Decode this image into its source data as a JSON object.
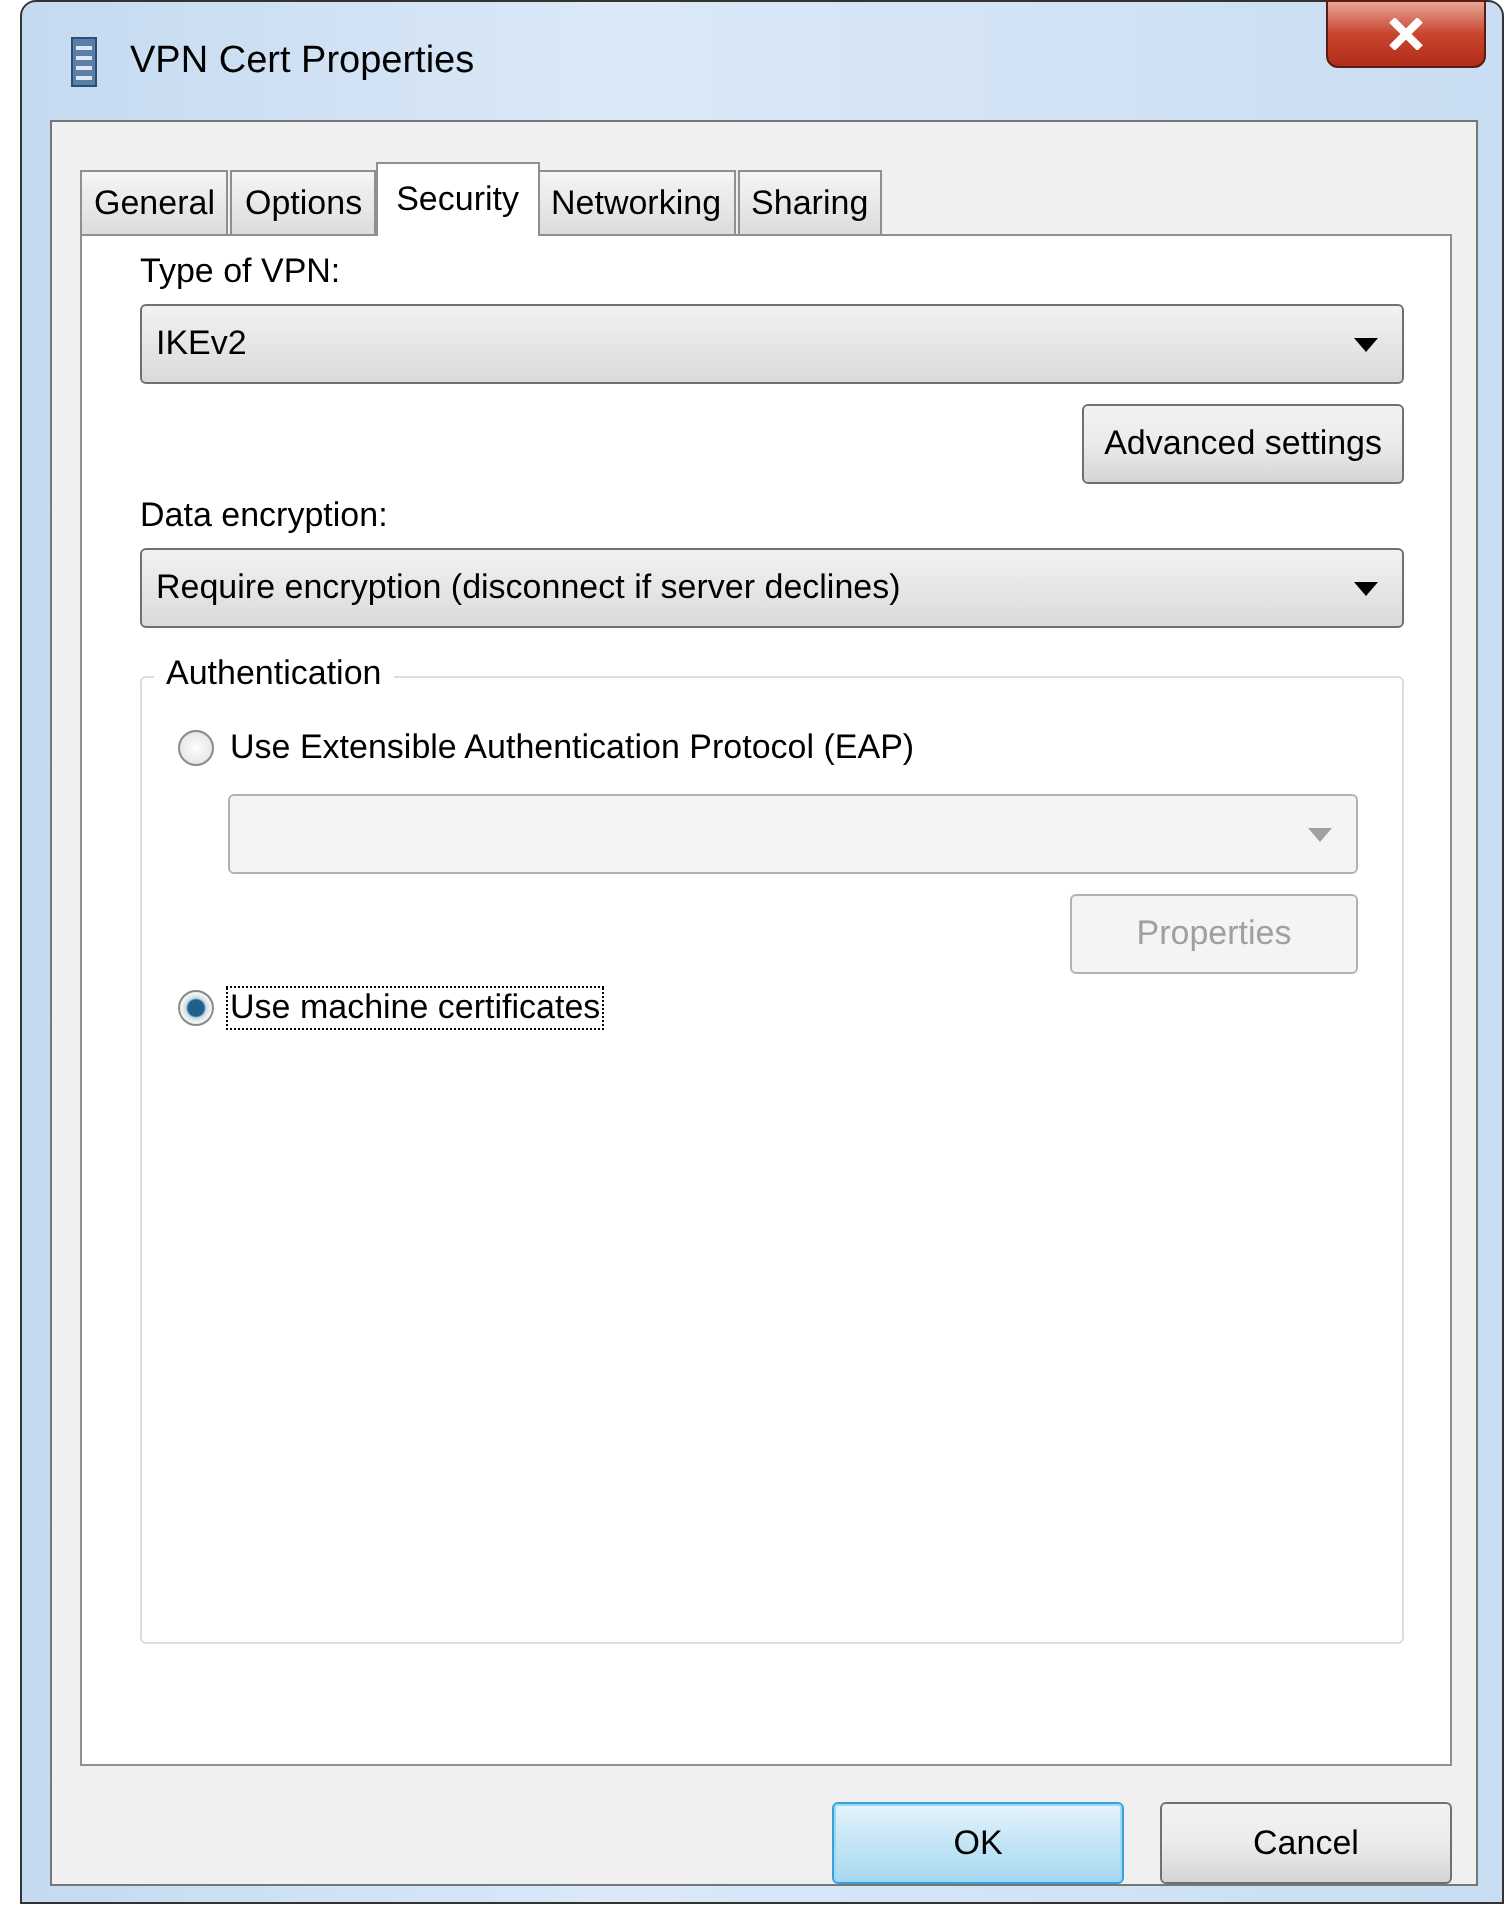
{
  "window": {
    "title": "VPN Cert Properties"
  },
  "tabs": [
    {
      "label": "General",
      "selected": false
    },
    {
      "label": "Options",
      "selected": false
    },
    {
      "label": "Security",
      "selected": true
    },
    {
      "label": "Networking",
      "selected": false
    },
    {
      "label": "Sharing",
      "selected": false
    }
  ],
  "type_of_vpn": {
    "label": "Type of VPN:",
    "value": "IKEv2"
  },
  "advanced_button": {
    "label": "Advanced settings"
  },
  "data_encryption": {
    "label": "Data encryption:",
    "value": "Require encryption (disconnect if server declines)"
  },
  "authentication": {
    "title": "Authentication",
    "eap": {
      "label": "Use Extensible Authentication Protocol (EAP)",
      "selected": false,
      "dropdown_disabled": true,
      "properties_label": "Properties",
      "properties_disabled": true
    },
    "certificates": {
      "label": "Use machine certificates",
      "selected": true
    }
  },
  "buttons": [
    {
      "label": "OK",
      "kind": "default"
    },
    {
      "label": "Cancel",
      "kind": "normal"
    }
  ]
}
